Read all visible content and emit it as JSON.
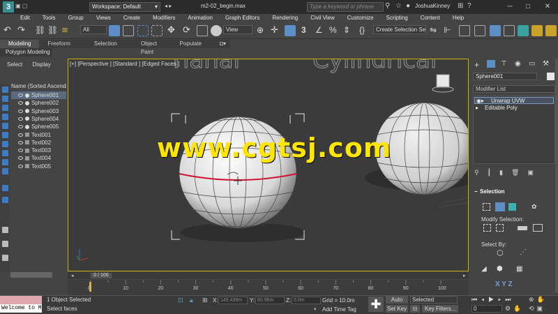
{
  "titlebar": {
    "app_logo": "3",
    "workspace": "Workspace: Default",
    "file_title": "m2-02_begin.max",
    "search_placeholder": "Type a keyword or phrase",
    "user": "JoshuaKinney",
    "win_min": "─",
    "win_max": "□",
    "win_close": "✕"
  },
  "menu": [
    "Edit",
    "Tools",
    "Group",
    "Views",
    "Create",
    "Modifiers",
    "Animation",
    "Graph Editors",
    "Rendering",
    "Civil View",
    "Customize",
    "Scripting",
    "Content",
    "Help"
  ],
  "toolbar": {
    "filter": "All",
    "ref_coord": "View",
    "selection_set": "Create Selection Se"
  },
  "ribbon": {
    "tabs": [
      "Modeling",
      "Freeform",
      "Selection",
      "Object Paint",
      "Populate"
    ],
    "active_tab": "Modeling",
    "sub_label": "Polygon Modeling"
  },
  "explorer": {
    "tabs": [
      "Select",
      "Display"
    ],
    "sort_header": "Name (Sorted Ascending",
    "items": [
      {
        "name": "Sphere001",
        "type": "sphere",
        "selected": true
      },
      {
        "name": "Sphere002",
        "type": "sphere",
        "selected": false
      },
      {
        "name": "Sphere003",
        "type": "sphere",
        "selected": false
      },
      {
        "name": "Sphere004",
        "type": "sphere",
        "selected": false
      },
      {
        "name": "Sphere005",
        "type": "sphere",
        "selected": false
      },
      {
        "name": "Text001",
        "type": "text",
        "selected": false
      },
      {
        "name": "Text002",
        "type": "text",
        "selected": false
      },
      {
        "name": "Text003",
        "type": "text",
        "selected": false
      },
      {
        "name": "Text004",
        "type": "text",
        "selected": false
      },
      {
        "name": "Text005",
        "type": "text",
        "selected": false
      }
    ]
  },
  "viewport": {
    "label": "[+] [Perspective ] [Standard ] [Edged Faces ]",
    "bg_text_left": "rianar",
    "bg_text_right": "Cylindrical",
    "watermark": "www.cgtsj.com",
    "highlight_color": "#c8b400"
  },
  "command_panel": {
    "object_name": "Sphere001",
    "modifier_list": "Modifier List",
    "stack": [
      {
        "label": "Unwrap UVW",
        "selected": true
      },
      {
        "label": "Editable Poly",
        "selected": false
      }
    ],
    "rollout_title": "Selection",
    "modify_selection_label": "Modify Selection:",
    "select_by_label": "Select By:"
  },
  "timeline": {
    "slider": "0 / 100",
    "ticks": [
      "0",
      "10",
      "20",
      "30",
      "40",
      "50",
      "60",
      "70",
      "80",
      "90",
      "100"
    ]
  },
  "status": {
    "maxscript_text": "Welcome to M",
    "objects_selected": "1 Object Selected",
    "prompt": "Select faces",
    "x_label": "X:",
    "x_value": "145.439m",
    "y_label": "Y:",
    "y_value": "80.96m",
    "z_label": "Z:",
    "z_value": "0.0m",
    "grid": "Grid = 10.0m",
    "add_time_tag": "Add Time Tag",
    "auto_key": "Auto Key",
    "set_key": "Set Key",
    "selected_dd": "Selected",
    "key_filters": "Key Filters...",
    "frame": "0"
  }
}
